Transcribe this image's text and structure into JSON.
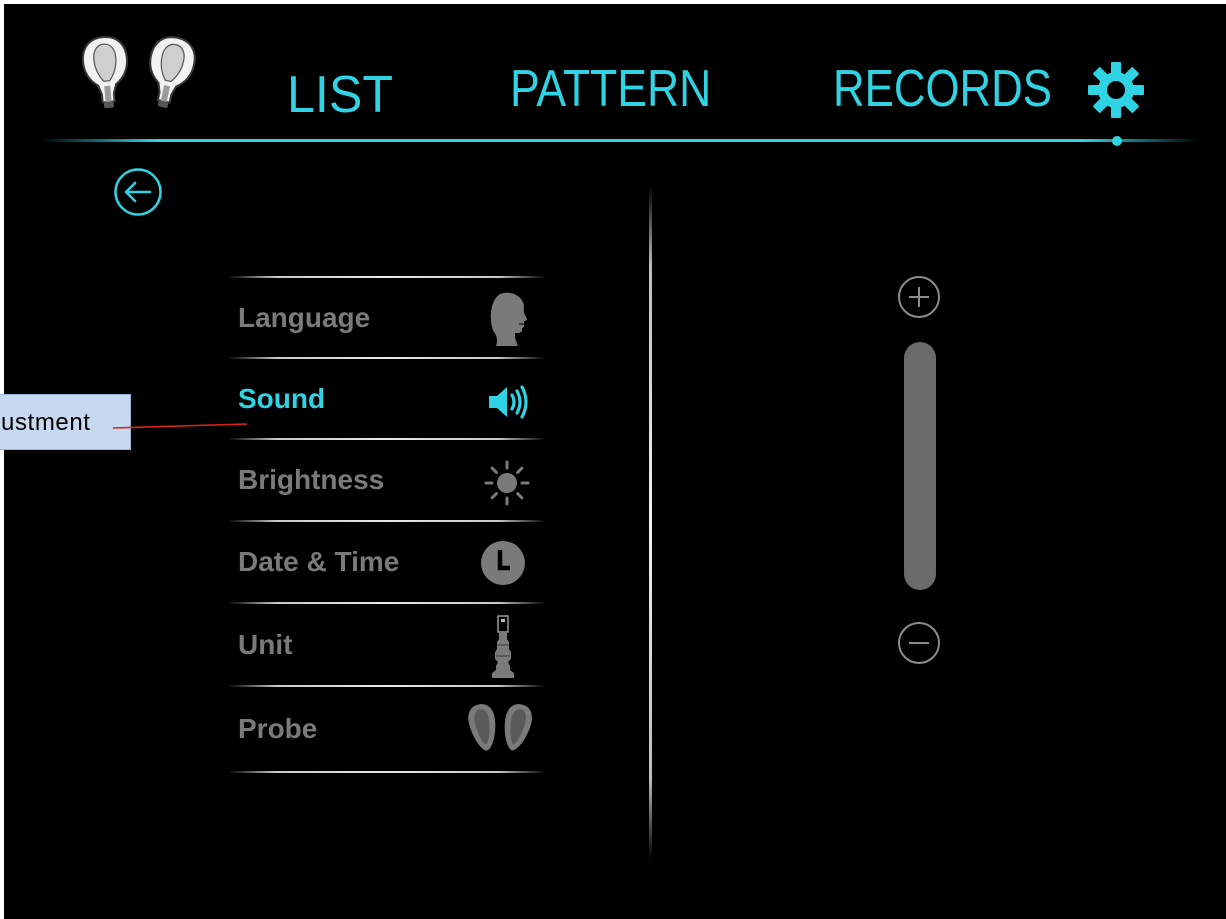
{
  "header": {
    "probe_status_icon": "probe-pair-icon",
    "tabs": [
      {
        "label": "LIST",
        "active": false
      },
      {
        "label": "PATTERN",
        "active": false
      },
      {
        "label": "RECORDS",
        "active": false
      }
    ],
    "settings": {
      "icon": "gear-icon",
      "active": true
    }
  },
  "settings": {
    "back_icon": "back-arrow-icon",
    "menu": [
      {
        "label": "Language",
        "icon": "head-icon",
        "active": false
      },
      {
        "label": "Sound",
        "icon": "speaker-icon",
        "active": true
      },
      {
        "label": "Brightness",
        "icon": "sun-icon",
        "active": false
      },
      {
        "label": "Date & Time",
        "icon": "clock-icon",
        "active": false
      },
      {
        "label": "Unit",
        "icon": "unit-icon",
        "active": false
      },
      {
        "label": "Probe",
        "icon": "probe-icon",
        "active": false
      }
    ]
  },
  "volume": {
    "increase_icon": "plus-circle-icon",
    "decrease_icon": "minus-circle-icon"
  },
  "annotation": {
    "text": "ustment"
  },
  "colors": {
    "accent": "#2fd3e4",
    "inactive": "#7a7a7a",
    "screen": "#000000",
    "slider": "#6a6a6a",
    "annotation_fill": "#c6d9f1",
    "annotation_line": "#d9261c"
  }
}
